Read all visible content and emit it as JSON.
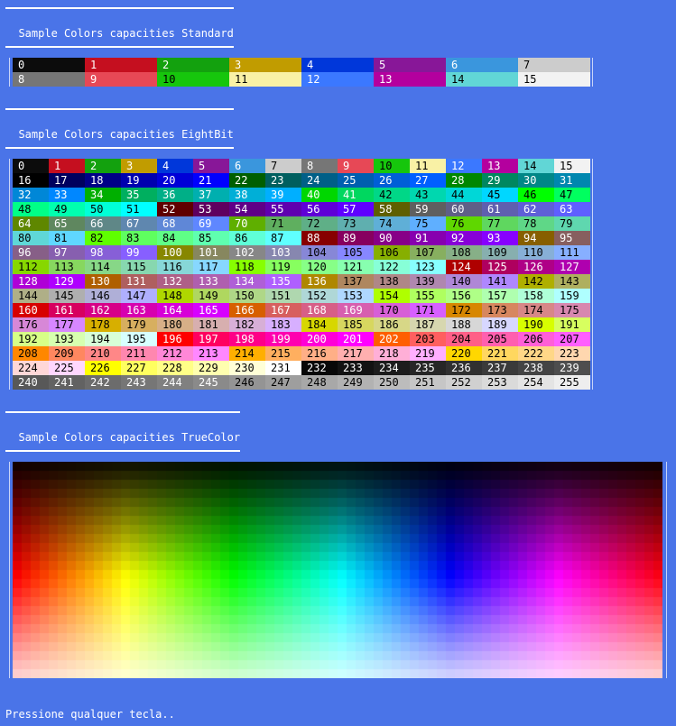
{
  "sections": {
    "standard": {
      "title": "Sample Colors capacities Standard"
    },
    "eightbit": {
      "title": "Sample Colors capacities EightBit"
    },
    "truecolor": {
      "title": "Sample Colors capacities TrueColor"
    }
  },
  "standard_colors": [
    {
      "label": "0",
      "bg": "#0c0c0c",
      "fg": "#ffffff"
    },
    {
      "label": "1",
      "bg": "#c50f1f",
      "fg": "#ffffff"
    },
    {
      "label": "2",
      "bg": "#13a10e",
      "fg": "#ffffff"
    },
    {
      "label": "3",
      "bg": "#c19c00",
      "fg": "#ffffff"
    },
    {
      "label": "4",
      "bg": "#0037da",
      "fg": "#ffffff"
    },
    {
      "label": "5",
      "bg": "#881798",
      "fg": "#ffffff"
    },
    {
      "label": "6",
      "bg": "#3a96dd",
      "fg": "#ffffff"
    },
    {
      "label": "7",
      "bg": "#cccccc",
      "fg": "#000000"
    },
    {
      "label": "8",
      "bg": "#767676",
      "fg": "#ffffff"
    },
    {
      "label": "9",
      "bg": "#e74856",
      "fg": "#ffffff"
    },
    {
      "label": "10",
      "bg": "#16c60c",
      "fg": "#000000"
    },
    {
      "label": "11",
      "bg": "#f9f1a5",
      "fg": "#000000"
    },
    {
      "label": "12",
      "bg": "#3b78ff",
      "fg": "#ffffff"
    },
    {
      "label": "13",
      "bg": "#b4009e",
      "fg": "#ffffff"
    },
    {
      "label": "14",
      "bg": "#61d6d6",
      "fg": "#000000"
    },
    {
      "label": "15",
      "bg": "#f2f2f2",
      "fg": "#000000"
    }
  ],
  "eightbit_labels": [
    "0",
    "1",
    "2",
    "3",
    "4",
    "5",
    "6",
    "7",
    "8",
    "9",
    "10",
    "11",
    "12",
    "13",
    "14",
    "15",
    "16",
    "17",
    "18",
    "19",
    "20",
    "21",
    "22",
    "23",
    "24",
    "25",
    "26",
    "27",
    "28",
    "29",
    "30",
    "31",
    "32",
    "33",
    "34",
    "35",
    "36",
    "37",
    "38",
    "39",
    "40",
    "41",
    "42",
    "43",
    "44",
    "45",
    "46",
    "47",
    "48",
    "49",
    "50",
    "51",
    "52",
    "53",
    "54",
    "55",
    "56",
    "57",
    "58",
    "59",
    "60",
    "61",
    "62",
    "63",
    "64",
    "65",
    "66",
    "67",
    "68",
    "69",
    "70",
    "71",
    "72",
    "73",
    "74",
    "75",
    "76",
    "77",
    "78",
    "79",
    "80",
    "81",
    "82",
    "83",
    "84",
    "85",
    "86",
    "87",
    "88",
    "89",
    "90",
    "91",
    "92",
    "93",
    "94",
    "95",
    "96",
    "97",
    "98",
    "99",
    "100",
    "101",
    "102",
    "103",
    "104",
    "105",
    "106",
    "107",
    "108",
    "109",
    "110",
    "111",
    "112",
    "113",
    "114",
    "115",
    "116",
    "117",
    "118",
    "119",
    "120",
    "121",
    "122",
    "123",
    "124",
    "125",
    "126",
    "127",
    "128",
    "129",
    "130",
    "131",
    "132",
    "133",
    "134",
    "135",
    "136",
    "137",
    "138",
    "139",
    "140",
    "141",
    "142",
    "143",
    "144",
    "145",
    "146",
    "147",
    "148",
    "149",
    "150",
    "151",
    "152",
    "153",
    "154",
    "155",
    "156",
    "157",
    "158",
    "159",
    "160",
    "161",
    "162",
    "163",
    "164",
    "165",
    "166",
    "167",
    "168",
    "169",
    "170",
    "171",
    "172",
    "173",
    "174",
    "175",
    "176",
    "177",
    "178",
    "179",
    "180",
    "181",
    "182",
    "183",
    "184",
    "185",
    "186",
    "187",
    "188",
    "189",
    "190",
    "191",
    "192",
    "193",
    "194",
    "195",
    "196",
    "197",
    "198",
    "199",
    "200",
    "201",
    "202",
    "203",
    "204",
    "205",
    "206",
    "207",
    "208",
    "209",
    "210",
    "211",
    "212",
    "213",
    "214",
    "215",
    "216",
    "217",
    "218",
    "219",
    "220",
    "221",
    "222",
    "223",
    "224",
    "225",
    "226",
    "227",
    "228",
    "229",
    "230",
    "231",
    "232",
    "233",
    "234",
    "235",
    "236",
    "237",
    "238",
    "239",
    "240",
    "241",
    "242",
    "243",
    "244",
    "245",
    "246",
    "247",
    "248",
    "249",
    "250",
    "251",
    "252",
    "253",
    "254",
    "255"
  ],
  "truecolor_gradient": {
    "description_kind": "hue sweep left-to-right, dark at top to light at bottom",
    "rows": 24,
    "cols": 72
  },
  "prompt": "Pressione qualquer tecla.."
}
